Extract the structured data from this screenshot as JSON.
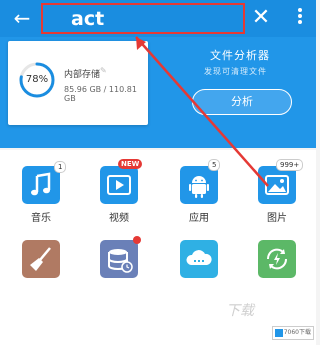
{
  "search": {
    "query": "act"
  },
  "storage": {
    "percent_text": "78%",
    "percent": 0.78,
    "label": "内部存储",
    "usage": "85.96 GB / 110.81 GB"
  },
  "analyzer": {
    "title": "文件分析器",
    "subtitle": "发现可清理文件",
    "button": "分析"
  },
  "categories": [
    {
      "label": "音乐",
      "badge": "1",
      "icon": "music-note-icon",
      "color": "#2196e8"
    },
    {
      "label": "视频",
      "badge": "NEW",
      "icon": "video-play-icon",
      "color": "#2196e8"
    },
    {
      "label": "应用",
      "badge": "5",
      "icon": "android-icon",
      "color": "#2196e8"
    },
    {
      "label": "图片",
      "badge": "999+",
      "icon": "image-icon",
      "color": "#2196e8"
    }
  ],
  "tools": [
    {
      "icon": "broom-icon",
      "color": "#b07a63"
    },
    {
      "icon": "stack-clock-icon",
      "color": "#6a80b8"
    },
    {
      "icon": "cloud-icon",
      "color": "#2fb0e4"
    },
    {
      "icon": "recycle-icon",
      "color": "#5cb867"
    }
  ],
  "watermark": {
    "text": "下载",
    "logo_text": "7060下载"
  },
  "colors": {
    "primary": "#1a8de0",
    "accent": "#e53935"
  }
}
